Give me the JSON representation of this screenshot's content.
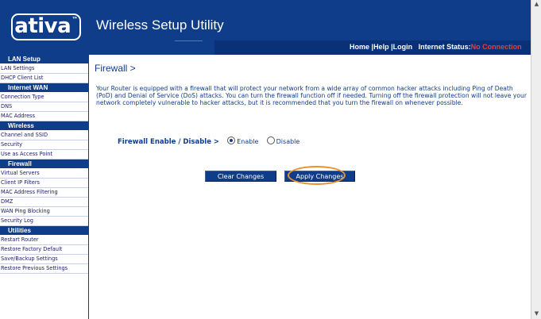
{
  "header": {
    "logo": "ativa",
    "logo_tm": "™",
    "app_title": "Wireless Setup Utility",
    "links": {
      "home": "Home",
      "help": "Help",
      "login": "Login",
      "sep": "|",
      "internet_status_label": "Internet Status:",
      "internet_status_value": "No Connection"
    },
    "status_color": "#e0403f"
  },
  "sidebar": {
    "sections": [
      {
        "title": "LAN Setup",
        "items": [
          "LAN Settings",
          "DHCP Client List"
        ]
      },
      {
        "title": "Internet WAN",
        "items": [
          "Connection Type",
          "DNS",
          "MAC Address"
        ]
      },
      {
        "title": "Wireless",
        "items": [
          "Channel and SSID",
          "Security",
          "Use as Access Point"
        ]
      },
      {
        "title": "Firewall",
        "items": [
          "Virtual Servers",
          "Client IP Filters",
          "MAC Address Filtering",
          "DMZ",
          "WAN Ping Blocking",
          "Security Log"
        ]
      },
      {
        "title": "Utilities",
        "items": [
          "Restart Router",
          "Restore Factory Default",
          "Save/Backup Settings",
          "Restore Previous Settings"
        ]
      }
    ]
  },
  "main": {
    "title": "Firewall >",
    "description": "Your Router is equipped with a firewall that will protect your network from a wide array of common hacker attacks including Ping of Death (PoD) and Denial of Service (DoS) attacks. You can turn the firewall function off if needed. Turning off the firewall protection will not leave your network completely vulnerable to hacker attacks, but it is recommended that you turn the firewall on whenever possible.",
    "firewall_label": "Firewall Enable / Disable >",
    "options": {
      "enable": "Enable",
      "disable": "Disable",
      "selected": "Enable"
    },
    "buttons": {
      "clear": "Clear Changes",
      "apply": "Apply Changes"
    },
    "highlight_color": "#e8922a"
  },
  "colors": {
    "brand_blue": "#0f3d8a"
  }
}
